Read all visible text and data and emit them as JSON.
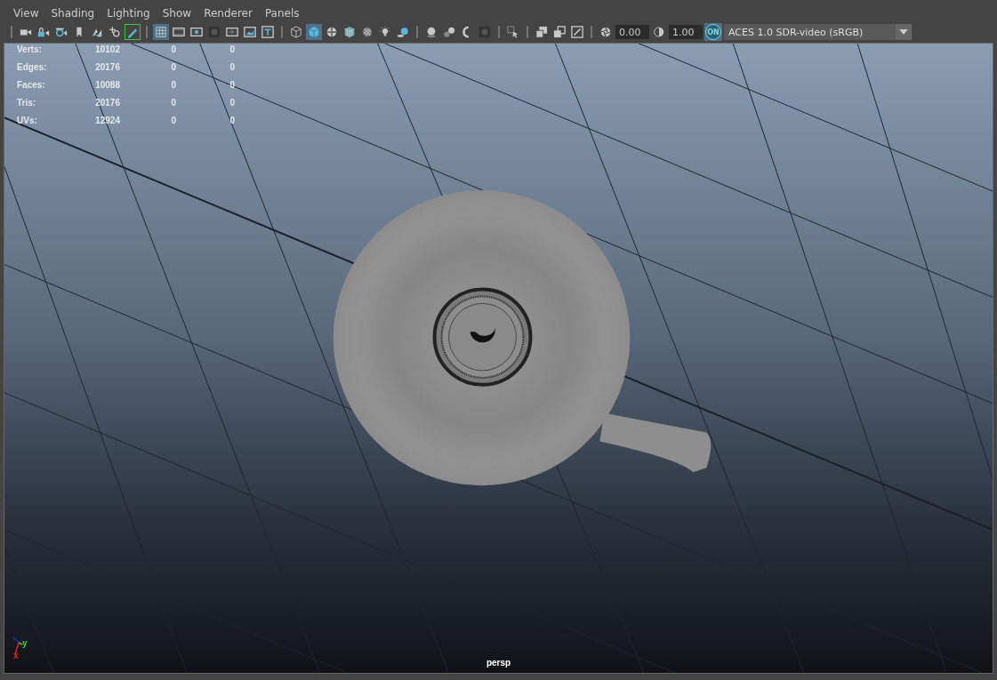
{
  "menu": [
    {
      "label": "View"
    },
    {
      "label": "Shading"
    },
    {
      "label": "Lighting"
    },
    {
      "label": "Show"
    },
    {
      "label": "Renderer"
    },
    {
      "label": "Panels"
    }
  ],
  "toolbar": {
    "groups": [
      [
        {
          "kind": "camera",
          "selected": false
        },
        {
          "kind": "camera-lock",
          "selected": false
        },
        {
          "kind": "camera-attr",
          "selected": false
        },
        {
          "kind": "bookmark",
          "selected": false
        },
        {
          "kind": "pan",
          "selected": false
        },
        {
          "kind": "zoom",
          "selected": false
        },
        {
          "kind": "pencil",
          "selected": true
        }
      ],
      [
        {
          "kind": "grid",
          "selected": true
        },
        {
          "kind": "film",
          "selected": false
        },
        {
          "kind": "gate",
          "selected": false
        },
        {
          "kind": "mask",
          "selected": false
        },
        {
          "kind": "chart",
          "selected": false
        },
        {
          "kind": "safe",
          "selected": false
        },
        {
          "kind": "title",
          "selected": false
        }
      ],
      [
        {
          "kind": "wire",
          "selected": false
        },
        {
          "kind": "shaded",
          "selected": true
        },
        {
          "kind": "ball",
          "selected": false
        },
        {
          "kind": "wireshaded",
          "selected": false
        },
        {
          "kind": "checker",
          "selected": false
        },
        {
          "kind": "light",
          "selected": false
        },
        {
          "kind": "shadow",
          "selected": false
        }
      ],
      [
        {
          "kind": "sphere",
          "selected": false
        },
        {
          "kind": "spheres",
          "selected": false
        },
        {
          "kind": "ring",
          "selected": false
        },
        {
          "kind": "mask",
          "selected": false
        }
      ],
      [
        {
          "kind": "select",
          "selected": false
        }
      ],
      [
        {
          "kind": "isolate",
          "selected": false
        },
        {
          "kind": "squares",
          "selected": false
        },
        {
          "kind": "xray",
          "selected": false
        }
      ],
      [
        {
          "kind": "exposure",
          "selected": false
        },
        {
          "kind": "field",
          "value": "0.00"
        },
        {
          "kind": "gamma",
          "selected": false
        },
        {
          "kind": "field",
          "value": "1.00"
        },
        {
          "kind": "toggle",
          "label": "ON",
          "selected": true
        },
        {
          "kind": "dropdown",
          "value": "ACES 1.0 SDR-video (sRGB)"
        }
      ]
    ]
  },
  "viewport": {
    "stats": [
      {
        "label": "Verts:",
        "values": [
          "10102",
          "0",
          "0"
        ]
      },
      {
        "label": "Edges:",
        "values": [
          "20176",
          "0",
          "0"
        ]
      },
      {
        "label": "Faces:",
        "values": [
          "10088",
          "0",
          "0"
        ]
      },
      {
        "label": "Tris:",
        "values": [
          "20176",
          "0",
          "0"
        ]
      },
      {
        "label": "UVs:",
        "values": [
          "12924",
          "0",
          "0"
        ]
      }
    ],
    "axes": [
      {
        "label": "y",
        "color": "#44cc44"
      },
      {
        "label": "x",
        "color": "#dd2222"
      }
    ],
    "camera": "persp"
  }
}
